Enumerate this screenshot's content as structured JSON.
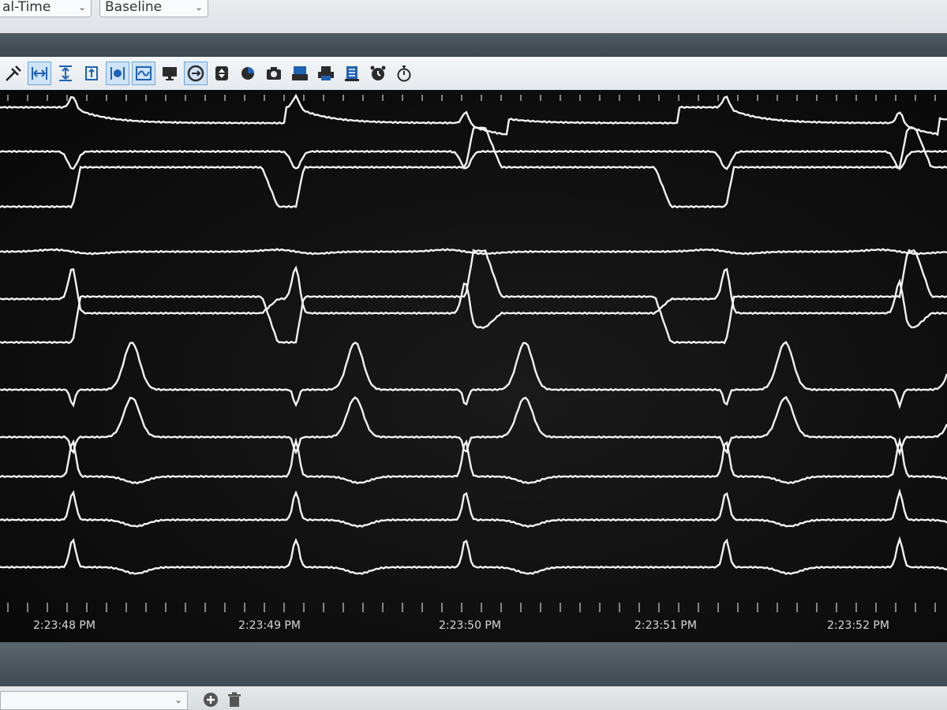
{
  "header": {
    "mode_select": {
      "value": "al-Time"
    },
    "view_select": {
      "value": "Baseline"
    }
  },
  "toolbar": {
    "buttons": [
      {
        "icon": "tools-icon"
      },
      {
        "icon": "fit-width-icon",
        "selected": true
      },
      {
        "icon": "fit-height-icon"
      },
      {
        "icon": "fit-range-icon"
      },
      {
        "icon": "channel-separate-icon",
        "selected": true
      },
      {
        "icon": "channel-overlay-icon",
        "selected": true
      },
      {
        "icon": "monitor-icon"
      },
      {
        "icon": "sync-icon",
        "selected": true
      },
      {
        "icon": "scale-icon"
      },
      {
        "icon": "pie-icon"
      },
      {
        "icon": "camera-icon"
      },
      {
        "icon": "review-icon"
      },
      {
        "icon": "print-icon"
      },
      {
        "icon": "report-icon"
      },
      {
        "icon": "alarm-clock-icon"
      },
      {
        "icon": "stopwatch-icon"
      }
    ]
  },
  "recording": {
    "time_axis": {
      "ticks": [
        "2:23:48 PM",
        "2:23:49 PM",
        "2:23:50 PM",
        "2:23:51 PM",
        "2:23:52 PM"
      ]
    },
    "channel_count": 11,
    "trace_color": "#f2f2f2",
    "background_color": "#0d0d0d"
  },
  "footer": {
    "add_icon": "plus-circle-icon",
    "delete_icon": "trash-icon"
  }
}
